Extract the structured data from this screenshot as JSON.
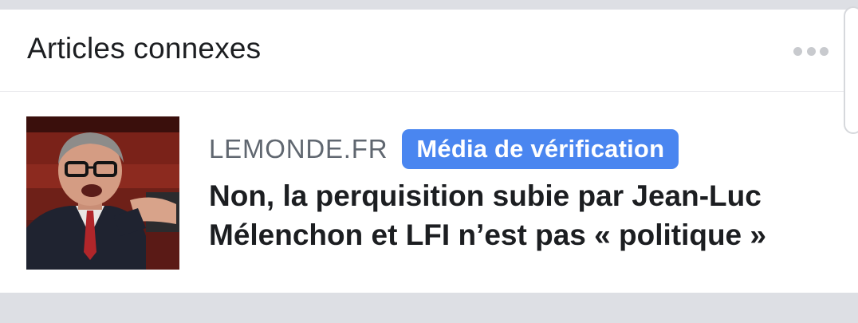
{
  "section": {
    "title": "Articles connexes",
    "more_icon": "more-horizontal-icon"
  },
  "article": {
    "source": "LEMONDE.FR",
    "badge": "Média de vérification",
    "headline": "Non, la perquisition subie par Jean-Luc Mélenchon et LFI n’est pas « politique »",
    "thumbnail_icon": "article-thumbnail-photo"
  },
  "colors": {
    "badge_bg": "#4a86f0",
    "page_bg": "#dddfe4",
    "card_bg": "#ffffff",
    "source_text": "#606770",
    "title_text": "#1c1e21"
  }
}
